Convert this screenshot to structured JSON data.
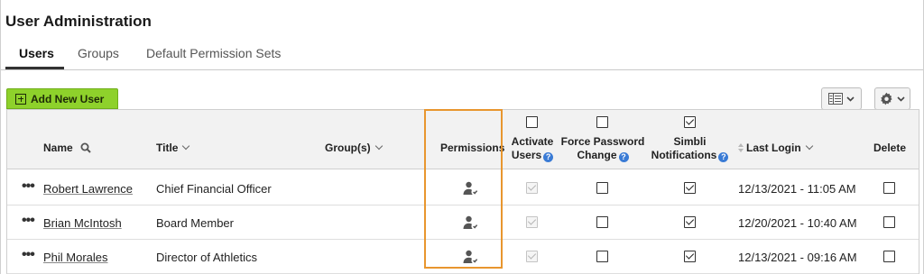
{
  "page": {
    "title": "User Administration"
  },
  "tabs": [
    {
      "label": "Users",
      "active": true
    },
    {
      "label": "Groups",
      "active": false
    },
    {
      "label": "Default Permission Sets",
      "active": false
    }
  ],
  "toolbar": {
    "add_user_label": "Add New User",
    "columns_icon": "columns-icon",
    "settings_icon": "gear-icon"
  },
  "columns": {
    "name": "Name",
    "title": "Title",
    "groups": "Group(s)",
    "permissions": "Permissions",
    "activate_line1": "Activate",
    "activate_line2": "Users",
    "force_line1": "Force Password",
    "force_line2": "Change",
    "simbli_line1": "Simbli",
    "simbli_line2": "Notifications",
    "last_login": "Last Login",
    "delete": "Delete"
  },
  "header_checks": {
    "activate": false,
    "force_password": false,
    "simbli": true
  },
  "rows": [
    {
      "name": "Robert Lawrence",
      "title": "Chief Financial Officer",
      "groups": "",
      "activate": true,
      "force_password": false,
      "simbli": true,
      "last_login": "12/13/2021 - 11:05 AM",
      "delete": false
    },
    {
      "name": "Brian McIntosh",
      "title": "Board Member",
      "groups": "",
      "activate": true,
      "force_password": false,
      "simbli": true,
      "last_login": "12/20/2021 - 10:40 AM",
      "delete": false
    },
    {
      "name": "Phil Morales",
      "title": "Director of Athletics",
      "groups": "",
      "activate": true,
      "force_password": false,
      "simbli": true,
      "last_login": "12/13/2021 - 09:16 AM",
      "delete": false
    }
  ],
  "colors": {
    "accent_green": "#8ed12b",
    "highlight": "#e8962e",
    "help_blue": "#3a7bd5"
  }
}
